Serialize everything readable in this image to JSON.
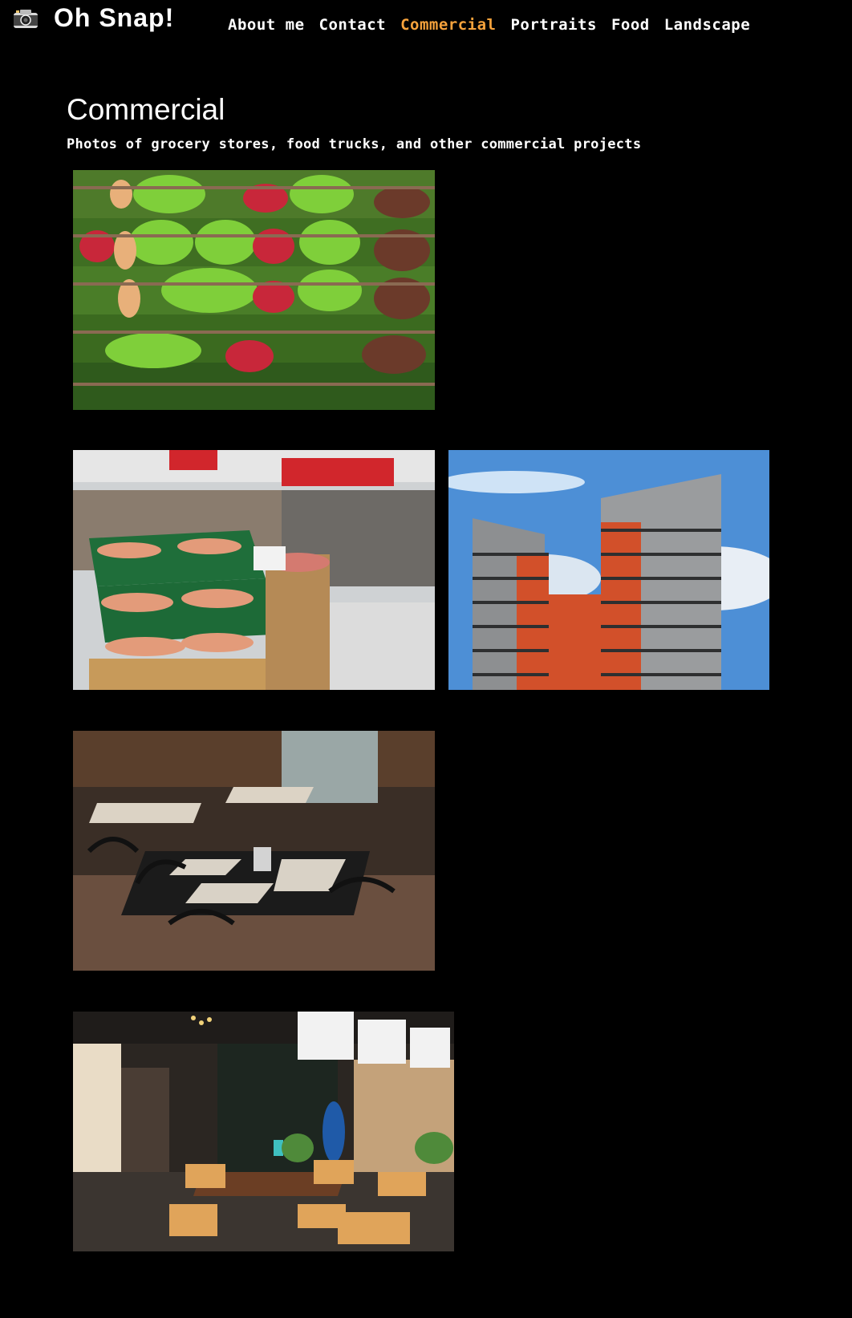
{
  "header": {
    "brand": "Oh Snap!",
    "nav": [
      {
        "label": "About me"
      },
      {
        "label": "Contact"
      },
      {
        "label": "Commercial",
        "active": true
      },
      {
        "label": "Portraits"
      },
      {
        "label": "Food"
      },
      {
        "label": "Landscape"
      }
    ],
    "accent_color": "#f7a33c"
  },
  "page": {
    "title": "Commercial",
    "subtitle": "Photos of grocery stores, food trucks, and other commercial projects"
  },
  "gallery": [
    {
      "subject": "grocery-produce-shelves"
    },
    {
      "subject": "supermarket-fruit-aisle"
    },
    {
      "subject": "apartment-towers"
    },
    {
      "subject": "restaurant-dining-room"
    },
    {
      "subject": "cafe-interior"
    }
  ]
}
